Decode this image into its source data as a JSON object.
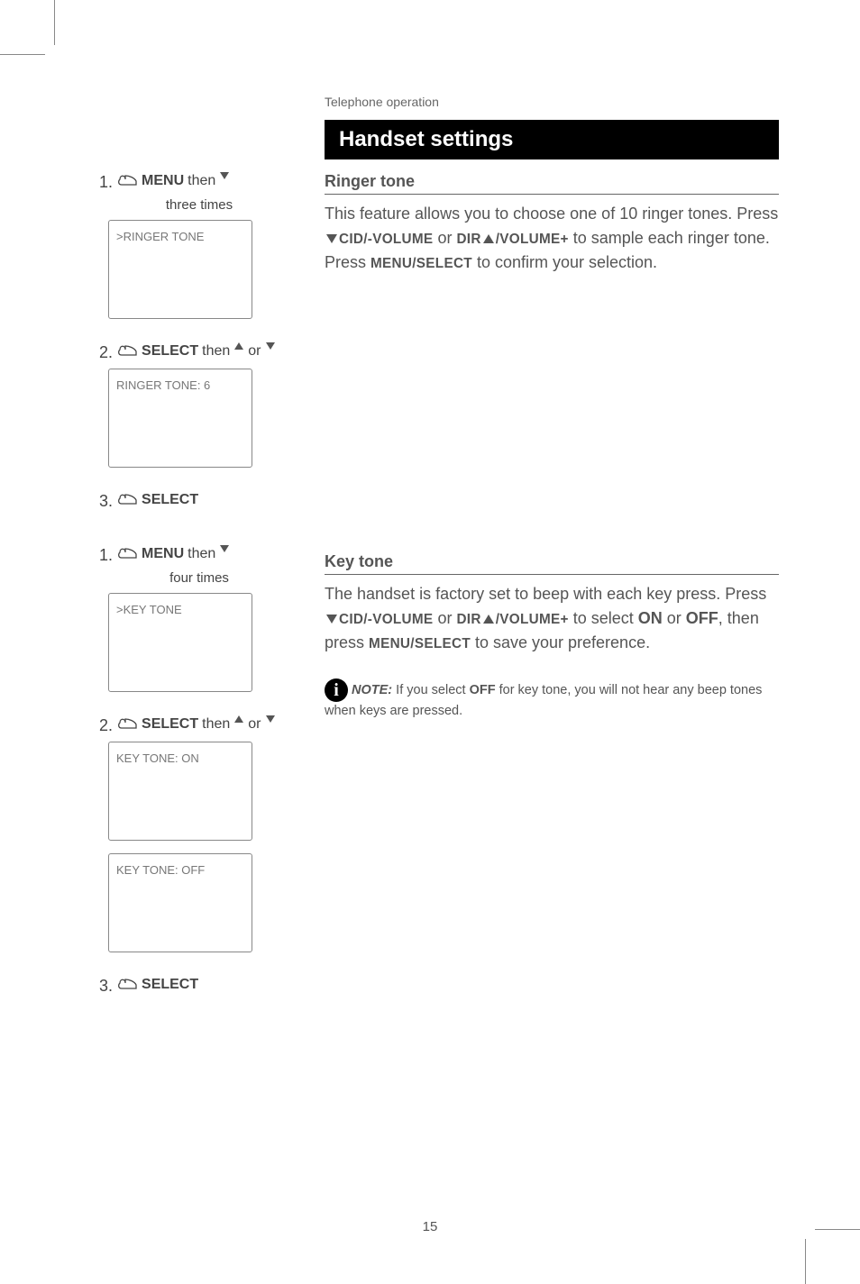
{
  "header": {
    "category": "Telephone operation"
  },
  "title": "Handset settings",
  "page_number": "15",
  "ringer": {
    "section_title": "Ringer tone",
    "body_parts": {
      "p1": "This feature allows you to choose one of 10 ringer tones. Press ",
      "btn1a": "CID/-VOLUME",
      "mid1": " or ",
      "btn1b": "DIR",
      "btn1c": "/VOLUME+",
      "p2": " to sample each ringer tone. Press ",
      "btn2": "MENU/SELECT",
      "p3": " to confirm your selection."
    },
    "steps": {
      "s1_num": "1.",
      "s1_label": "MENU",
      "s1_then": " then ",
      "s1_trail": "three times",
      "s1_screen": ">RINGER TONE",
      "s2_num": "2.",
      "s2_label": "SELECT",
      "s2_then": " then ",
      "s2_or": "or",
      "s2_screen": "RINGER TONE: 6",
      "s3_num": "3.",
      "s3_label": "SELECT"
    }
  },
  "keytone": {
    "section_title": "Key tone",
    "body_parts": {
      "p1": "The handset is factory set to beep with each key press. Press ",
      "btn1a": "CID/-VOLUME",
      "mid1": " or ",
      "btn1b": "DIR",
      "btn1c": "/VOLUME+",
      "p2": " to select ",
      "on": "ON",
      "or": " or ",
      "off": "OFF",
      "p3": ", then press ",
      "btn2": "MENU/SELECT",
      "p4": " to save your preference."
    },
    "note": {
      "label": "NOTE:",
      "t1": " If you select ",
      "off": "OFF",
      "t2": " for key tone, you will not hear any beep tones when keys are pressed."
    },
    "steps": {
      "s1_num": "1.",
      "s1_label": "MENU",
      "s1_then": " then ",
      "s1_trail": "four times",
      "s1_screen": ">KEY TONE",
      "s2_num": "2.",
      "s2_label": "SELECT",
      "s2_then": " then ",
      "s2_or": "or",
      "s2_screen_a": "KEY TONE:  ON",
      "s2_screen_b": "KEY TONE:  OFF",
      "s3_num": "3.",
      "s3_label": "SELECT"
    }
  }
}
